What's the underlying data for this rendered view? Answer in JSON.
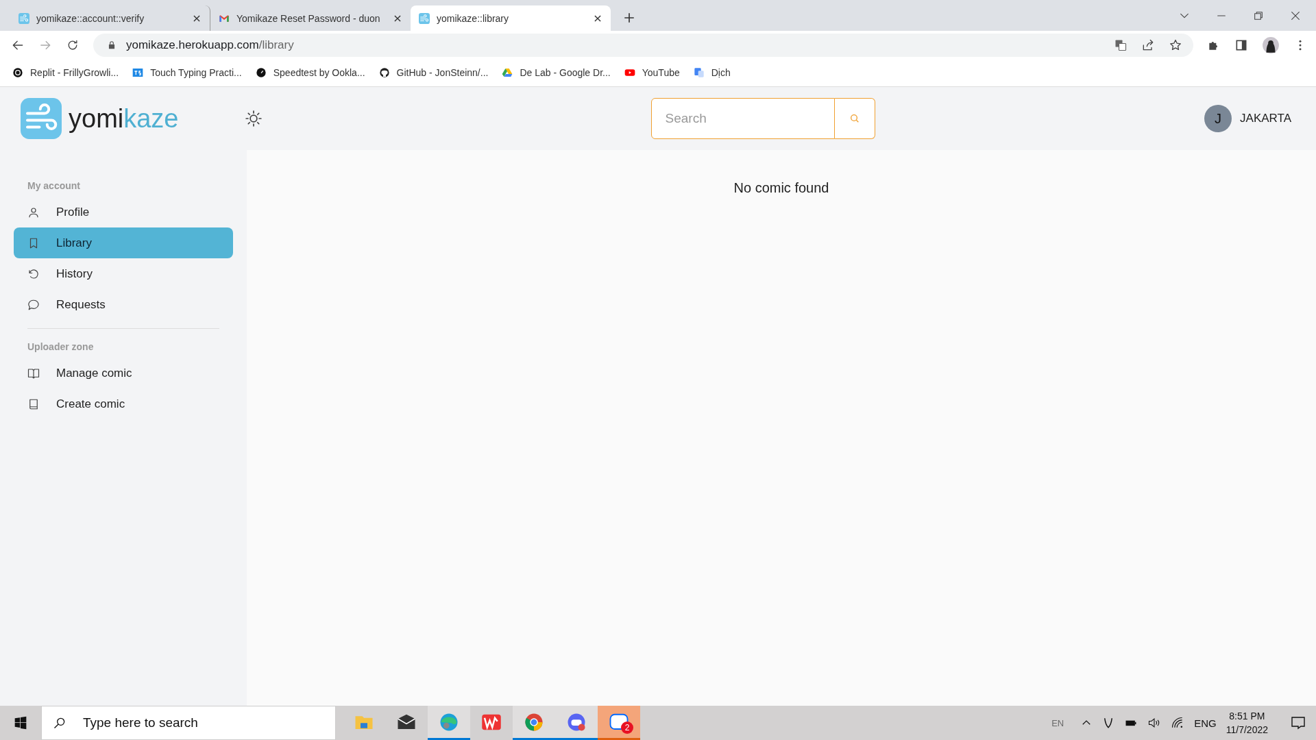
{
  "browser": {
    "tabs": [
      {
        "title": "yomikaze::account::verify",
        "selected": false
      },
      {
        "title": "Yomikaze Reset Password - duon",
        "selected": false
      },
      {
        "title": "yomikaze::library",
        "selected": true
      }
    ],
    "address": {
      "host": "yomikaze.herokuapp.com",
      "path": "/library"
    },
    "bookmarks": [
      "Replit - FrillyGrowli...",
      "Touch Typing Practi...",
      "Speedtest by Ookla...",
      "GitHub - JonSteinn/...",
      "De Lab - Google Dr...",
      "YouTube",
      "Dịch"
    ]
  },
  "header": {
    "logo": {
      "part_1": "yomi",
      "part_2": "kaze"
    },
    "search": {
      "placeholder": "Search"
    },
    "user": {
      "initial": "J",
      "name": "JAKARTA"
    }
  },
  "sidebar": {
    "sections": [
      {
        "title": "My account",
        "items": [
          {
            "label": "Profile",
            "selected": false
          },
          {
            "label": "Library",
            "selected": true
          },
          {
            "label": "History",
            "selected": false
          },
          {
            "label": "Requests",
            "selected": false
          }
        ]
      },
      {
        "title": "Uploader zone",
        "items": [
          {
            "label": "Manage comic",
            "selected": false
          },
          {
            "label": "Create comic",
            "selected": false
          }
        ]
      }
    ]
  },
  "main": {
    "message": "No comic found"
  },
  "taskbar": {
    "search": {
      "placeholder": "Type here to search"
    },
    "apps": [
      {
        "running": false
      },
      {
        "running": false
      },
      {
        "running": true
      },
      {
        "running": false
      },
      {
        "running": true
      },
      {
        "running": true
      },
      {
        "running": true,
        "selected": true,
        "badge": "2"
      }
    ],
    "tray": {
      "ime": "EN",
      "language": "ENG",
      "time": "8:51 PM",
      "date": "11/7/2022"
    }
  }
}
